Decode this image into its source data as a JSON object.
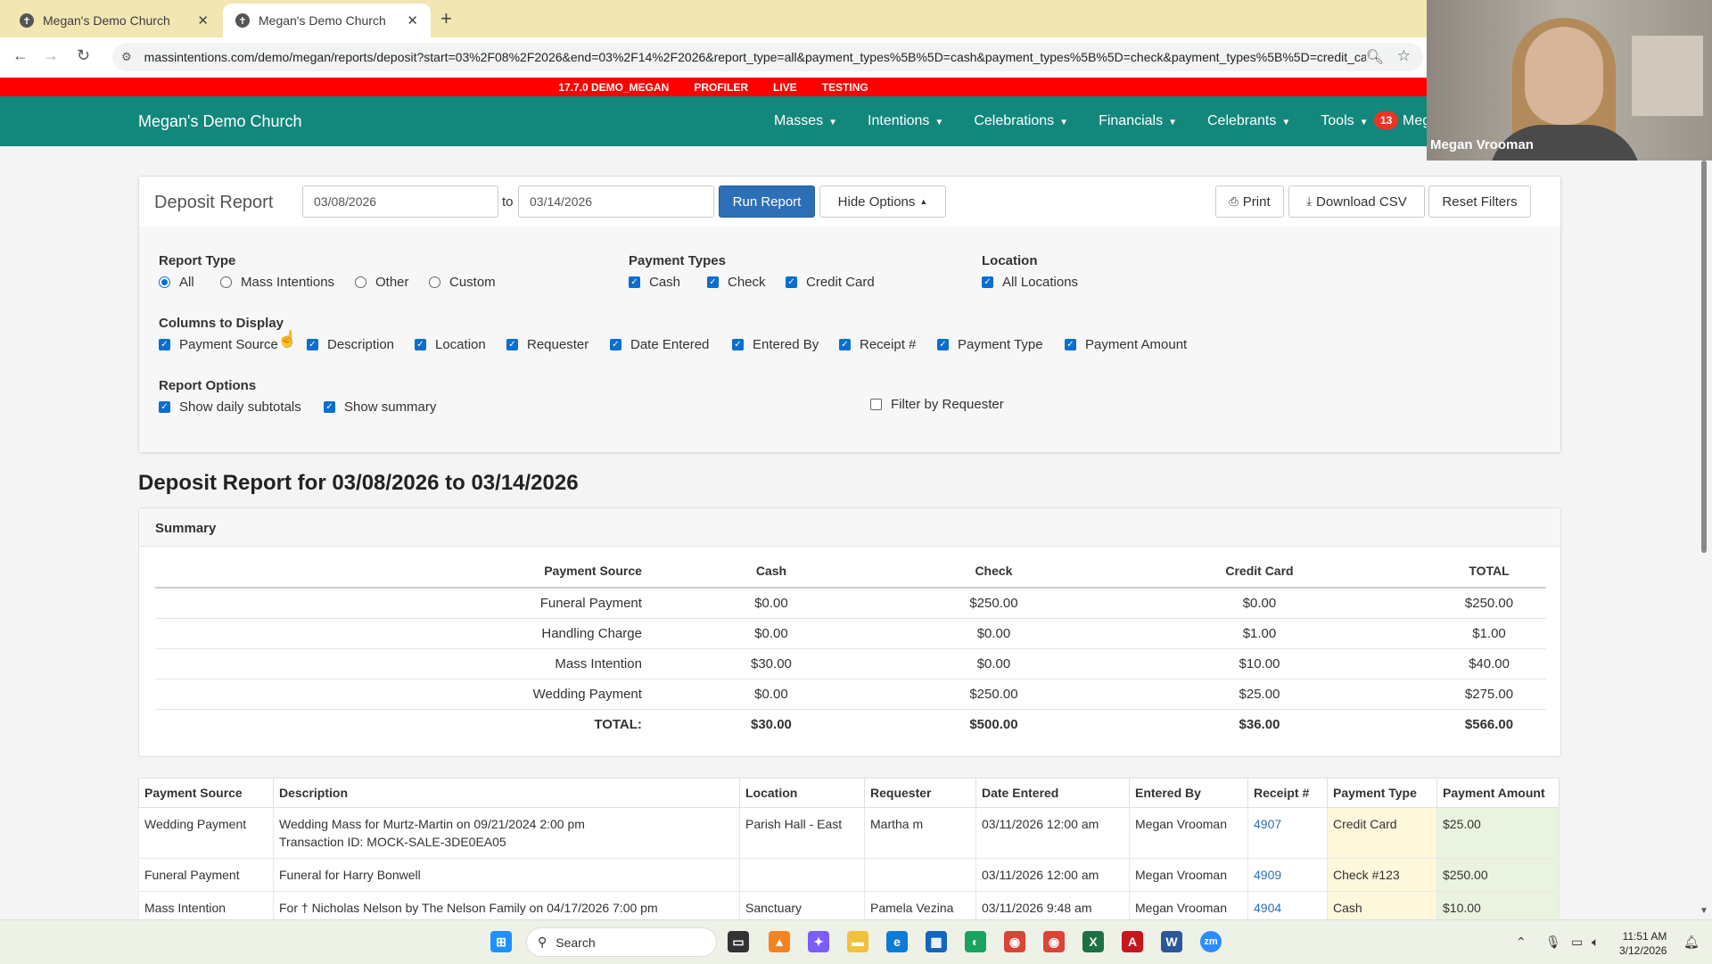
{
  "browser": {
    "tabs": [
      {
        "title": "Megan's Demo Church",
        "active": false
      },
      {
        "title": "Megan's Demo Church",
        "active": true
      }
    ],
    "url": "massintentions.com/demo/megan/reports/deposit?start=03%2F08%2F2026&end=03%2F14%2F2026&report_type=all&payment_types%5B%5D=cash&payment_types%5B%5D=check&payment_types%5B%5D=credit_car..."
  },
  "env_bar": [
    "17.7.0 DEMO_MEGAN",
    "PROFILER",
    "LIVE",
    "TESTING"
  ],
  "nav": {
    "brand": "Megan's Demo Church",
    "menus": [
      "Masses",
      "Intentions",
      "Celebrations",
      "Financials",
      "Celebrants",
      "Tools"
    ],
    "badge_count": "13",
    "user_short": "Meg"
  },
  "video": {
    "name": "Megan Vrooman"
  },
  "report_bar": {
    "title": "Deposit Report",
    "start_date": "03/08/2026",
    "to_label": "to",
    "end_date": "03/14/2026",
    "run_label": "Run Report",
    "hide_label": "Hide Options",
    "print_label": "Print",
    "download_label": "Download CSV",
    "reset_label": "Reset Filters"
  },
  "options": {
    "report_type_label": "Report Type",
    "report_types": [
      "All",
      "Mass Intentions",
      "Other",
      "Custom"
    ],
    "report_type_selected": "All",
    "payment_types_label": "Payment Types",
    "payment_types": [
      "Cash",
      "Check",
      "Credit Card"
    ],
    "location_label": "Location",
    "location_option": "All Locations",
    "columns_label": "Columns to Display",
    "columns": [
      "Payment Source",
      "Description",
      "Location",
      "Requester",
      "Date Entered",
      "Entered By",
      "Receipt #",
      "Payment Type",
      "Payment Amount"
    ],
    "report_options_label": "Report Options",
    "report_options": [
      "Show daily subtotals",
      "Show summary"
    ],
    "filter_requester": "Filter by Requester"
  },
  "heading": "Deposit Report for 03/08/2026 to 03/14/2026",
  "summary": {
    "title": "Summary",
    "headers": [
      "Payment Source",
      "Cash",
      "Check",
      "Credit Card",
      "TOTAL"
    ],
    "rows": [
      [
        "Funeral Payment",
        "$0.00",
        "$250.00",
        "$0.00",
        "$250.00"
      ],
      [
        "Handling Charge",
        "$0.00",
        "$0.00",
        "$1.00",
        "$1.00"
      ],
      [
        "Mass Intention",
        "$30.00",
        "$0.00",
        "$10.00",
        "$40.00"
      ],
      [
        "Wedding Payment",
        "$0.00",
        "$250.00",
        "$25.00",
        "$275.00"
      ]
    ],
    "total_row": [
      "TOTAL:",
      "$30.00",
      "$500.00",
      "$36.00",
      "$566.00"
    ]
  },
  "details": {
    "headers": [
      "Payment Source",
      "Description",
      "Location",
      "Requester",
      "Date Entered",
      "Entered By",
      "Receipt #",
      "Payment Type",
      "Payment Amount"
    ],
    "rows": [
      {
        "source": "Wedding Payment",
        "desc1": "Wedding Mass for Murtz-Martin on 09/21/2024 2:00 pm",
        "desc2": "Transaction ID: MOCK-SALE-3DE0EA05",
        "location": "Parish Hall - East",
        "requester": "Martha m",
        "date": "03/11/2026 12:00 am",
        "entered_by": "Megan Vrooman",
        "receipt": "4907",
        "ptype": "Credit Card",
        "amount": "$25.00"
      },
      {
        "source": "Funeral Payment",
        "desc1": "Funeral for Harry Bonwell",
        "desc2": "",
        "location": "",
        "requester": "",
        "date": "03/11/2026 12:00 am",
        "entered_by": "Megan Vrooman",
        "receipt": "4909",
        "ptype": "Check #123",
        "amount": "$250.00"
      },
      {
        "source": "Mass Intention",
        "desc1": "For † Nicholas Nelson by The Nelson Family on 04/17/2026 7:00 pm",
        "desc2": "",
        "location": "Sanctuary",
        "requester": "Pamela Vezina",
        "date": "03/11/2026 9:48 am",
        "entered_by": "Megan Vrooman",
        "receipt": "4904",
        "ptype": "Cash",
        "amount": "$10.00"
      }
    ]
  },
  "taskbar": {
    "search_placeholder": "Search",
    "time": "11:51 AM",
    "date": "3/12/2026"
  },
  "colors": {
    "nav_bg": "#12877c",
    "env_bar": "#ff0000",
    "primary_btn": "#2d6fb7",
    "ptype_bg": "#fdf7dc",
    "amount_bg": "#e9f3df"
  }
}
